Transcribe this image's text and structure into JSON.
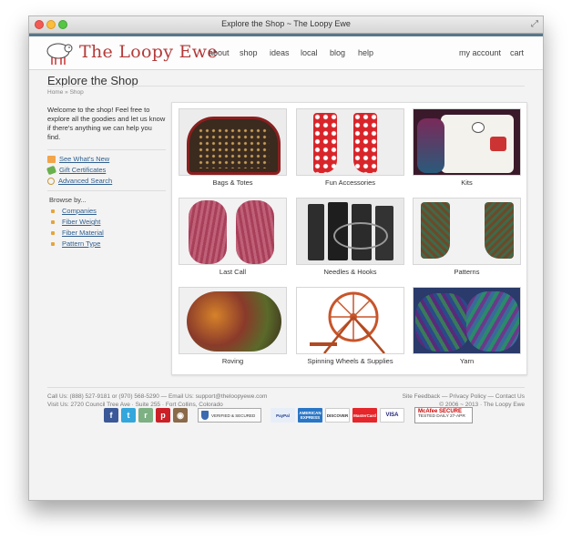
{
  "window": {
    "title": "Explore the Shop ~ The Loopy Ewe"
  },
  "header": {
    "logo_text": "The Loopy Ewe",
    "nav": [
      "about",
      "shop",
      "ideas",
      "local",
      "blog",
      "help"
    ],
    "account": "my account",
    "cart": "cart"
  },
  "page": {
    "title": "Explore the Shop",
    "breadcrumb": "Home  »  Shop"
  },
  "sidebar": {
    "welcome": "Welcome to the shop! Feel free to explore all the goodies and let us know if there's anything we can help you find.",
    "links": [
      "See What's New",
      "Gift Certificates",
      "Advanced Search"
    ],
    "browse_title": "Browse by...",
    "browse": [
      "Companies",
      "Fiber Weight",
      "Fiber Material",
      "Pattern Type"
    ]
  },
  "tiles": [
    {
      "label": "Bags & Totes"
    },
    {
      "label": "Fun Accessories"
    },
    {
      "label": "Kits"
    },
    {
      "label": "Last Call"
    },
    {
      "label": "Needles & Hooks"
    },
    {
      "label": "Patterns"
    },
    {
      "label": "Roving"
    },
    {
      "label": "Spinning Wheels & Supplies"
    },
    {
      "label": "Yarn"
    }
  ],
  "footer": {
    "call": "Call Us: (888) 527-9181 or (970) 568-5290 — Email Us: support@theloopyewe.com",
    "visit": "Visit Us: 2720 Council Tree Ave · Suite 255 · Fort Collins, Colorado",
    "links": "Site Feedback — Privacy Policy — Contact Us",
    "copyright": "© 2006 ~ 2013 · The Loopy Ewe"
  },
  "badges": {
    "social": [
      "f",
      "t",
      "r",
      "p",
      "◉"
    ],
    "verified": "VERIFIED & SECURED",
    "cards": [
      "PayPal",
      "AMERICAN EXPRESS",
      "DISCOVER",
      "MasterCard",
      "VISA"
    ],
    "mcafee": "McAfee SECURE",
    "mcafee_sub": "TESTED DAILY   27-APR"
  },
  "colors": {
    "brand": "#b43a3a",
    "header_bar": "#5a7688",
    "link": "#2f5f8f",
    "bullet": "#e6a43a"
  }
}
